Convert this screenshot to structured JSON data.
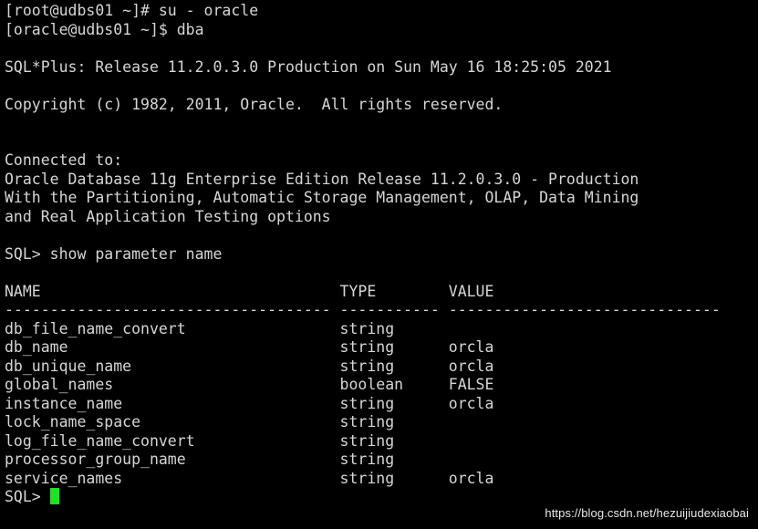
{
  "terminal": {
    "lines": [
      "[root@udbs01 ~]# su - oracle",
      "[oracle@udbs01 ~]$ dba",
      "",
      "SQL*Plus: Release 11.2.0.3.0 Production on Sun May 16 18:25:05 2021",
      "",
      "Copyright (c) 1982, 2011, Oracle.  All rights reserved.",
      "",
      "",
      "Connected to:",
      "Oracle Database 11g Enterprise Edition Release 11.2.0.3.0 - Production",
      "With the Partitioning, Automatic Storage Management, OLAP, Data Mining",
      "and Real Application Testing options",
      "",
      "SQL> show parameter name",
      "",
      "NAME                                 TYPE        VALUE",
      "------------------------------------ ----------- ------------------------------",
      "db_file_name_convert                 string",
      "db_name                              string      orcla",
      "db_unique_name                       string      orcla",
      "global_names                         boolean     FALSE",
      "instance_name                        string      orcla",
      "lock_name_space                      string",
      "log_file_name_convert                string",
      "processor_group_name                 string",
      "service_names                        string      orcla"
    ],
    "prompt": "SQL> ",
    "cursor_color": "#22e022",
    "background_color": "#000000",
    "text_color": "#d6d6d6"
  },
  "watermark": {
    "text": "https://blog.csdn.net/hezuijiudexiaobai"
  }
}
